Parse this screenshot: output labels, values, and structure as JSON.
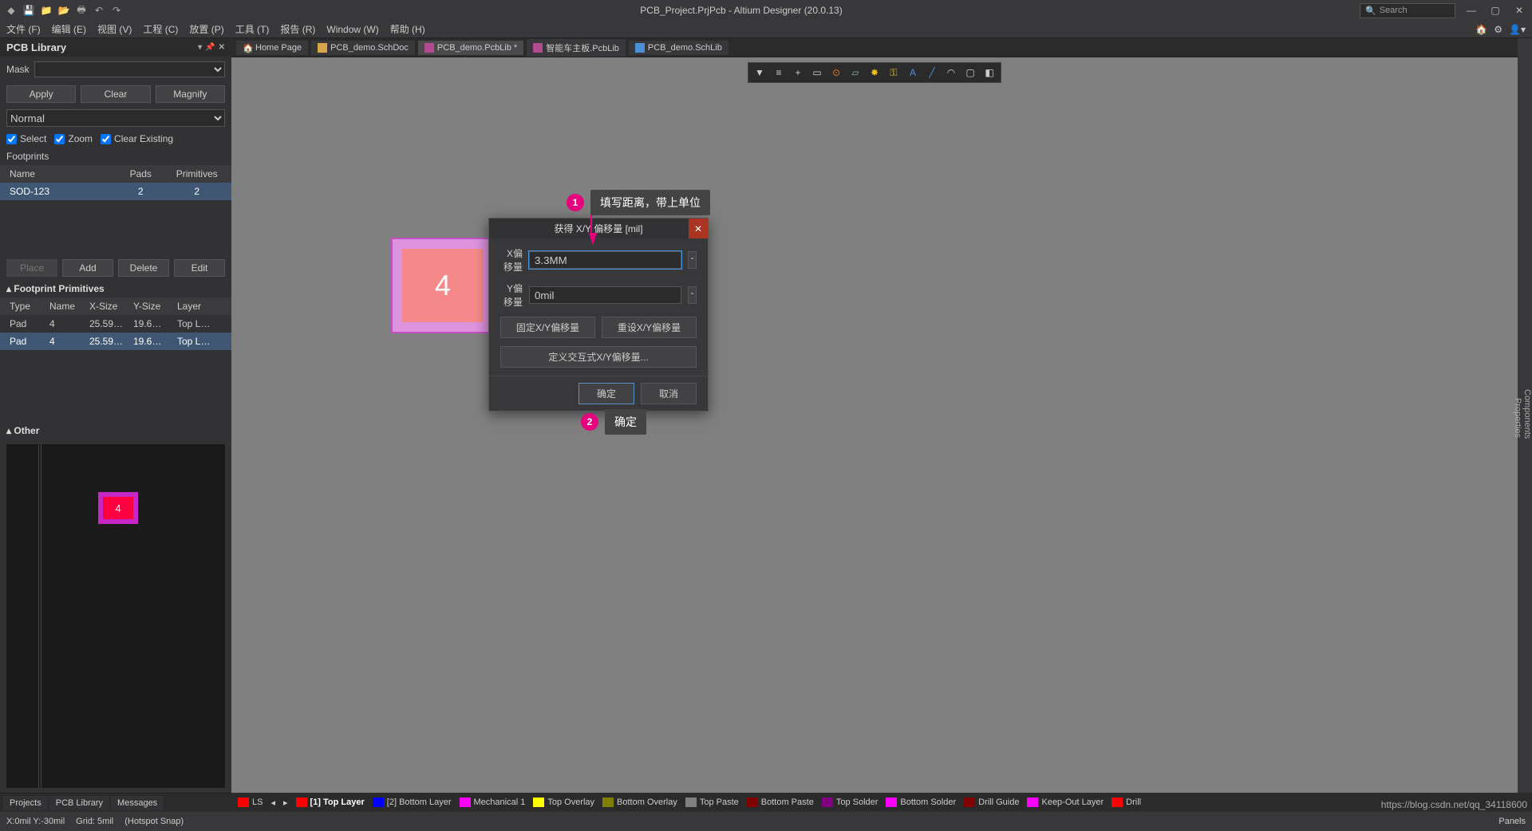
{
  "title": "PCB_Project.PrjPcb - Altium Designer (20.0.13)",
  "search_placeholder": "Search",
  "menu": [
    "文件 (F)",
    "编辑 (E)",
    "视图 (V)",
    "工程 (C)",
    "放置 (P)",
    "工具 (T)",
    "报告 (R)",
    "Window (W)",
    "帮助 (H)"
  ],
  "panel": {
    "title": "PCB Library",
    "mask_label": "Mask",
    "buttons": {
      "apply": "Apply",
      "clear": "Clear",
      "magnify": "Magnify"
    },
    "mode": "Normal",
    "checks": {
      "select": "Select",
      "zoom": "Zoom",
      "clear_existing": "Clear Existing"
    },
    "footprints_label": "Footprints",
    "fp_cols": {
      "name": "Name",
      "pads": "Pads",
      "prim": "Primitives"
    },
    "fp_row": {
      "name": "SOD-123",
      "pads": "2",
      "prim": "2"
    },
    "fp_btns": {
      "place": "Place",
      "add": "Add",
      "delete": "Delete",
      "edit": "Edit"
    },
    "prim_title": "Footprint Primitives",
    "prim_cols": {
      "type": "Type",
      "name": "Name",
      "xsize": "X-Size",
      "ysize": "Y-Size",
      "layer": "Layer"
    },
    "prim_rows": [
      {
        "type": "Pad",
        "name": "4",
        "xsize": "25.59…",
        "ysize": "19.6…",
        "layer": "Top L…"
      },
      {
        "type": "Pad",
        "name": "4",
        "xsize": "25.59…",
        "ysize": "19.6…",
        "layer": "Top L…"
      }
    ],
    "other_title": "Other"
  },
  "bottom_tabs": [
    "Projects",
    "PCB Library",
    "Messages"
  ],
  "doc_tabs": [
    {
      "label": "Home Page",
      "active": false
    },
    {
      "label": "PCB_demo.SchDoc",
      "active": false
    },
    {
      "label": "PCB_demo.PcbLib *",
      "active": true
    },
    {
      "label": "智能车主板.PcbLib",
      "active": false
    },
    {
      "label": "PCB_demo.SchLib",
      "active": false
    }
  ],
  "right_strip": {
    "components": "Components",
    "properties": "Properties"
  },
  "pad_label": "4",
  "preview_label": "4",
  "dialog": {
    "title": "获得 X/Y 偏移量 [mil]",
    "x_label": "X偏移量",
    "y_label": "Y偏移量",
    "x_val": "3.3MM",
    "y_val": "0mil",
    "fix": "固定X/Y偏移量",
    "reset": "重设X/Y偏移量",
    "define": "定义交互式X/Y偏移量...",
    "ok": "确定",
    "cancel": "取消"
  },
  "callouts": {
    "one": "填写距离，带上单位",
    "two": "确定"
  },
  "layers": {
    "ls": "LS",
    "items": [
      {
        "color": "#ff0000",
        "label": "[1] Top Layer",
        "active": true
      },
      {
        "color": "#0000ff",
        "label": "[2] Bottom Layer"
      },
      {
        "color": "#ff00ff",
        "label": "Mechanical 1"
      },
      {
        "color": "#ffff00",
        "label": "Top Overlay"
      },
      {
        "color": "#808000",
        "label": "Bottom Overlay"
      },
      {
        "color": "#808080",
        "label": "Top Paste"
      },
      {
        "color": "#800000",
        "label": "Bottom Paste"
      },
      {
        "color": "#800080",
        "label": "Top Solder"
      },
      {
        "color": "#ff00ff",
        "label": "Bottom Solder"
      },
      {
        "color": "#800000",
        "label": "Drill Guide"
      },
      {
        "color": "#ff00ff",
        "label": "Keep-Out Layer"
      },
      {
        "color": "#ff0000",
        "label": "Drill"
      }
    ]
  },
  "status": {
    "coord": "X:0mil Y:-30mil",
    "grid": "Grid: 5mil",
    "snap": "(Hotspot Snap)",
    "panels": "Panels"
  },
  "watermark": "https://blog.csdn.net/qq_34118600"
}
